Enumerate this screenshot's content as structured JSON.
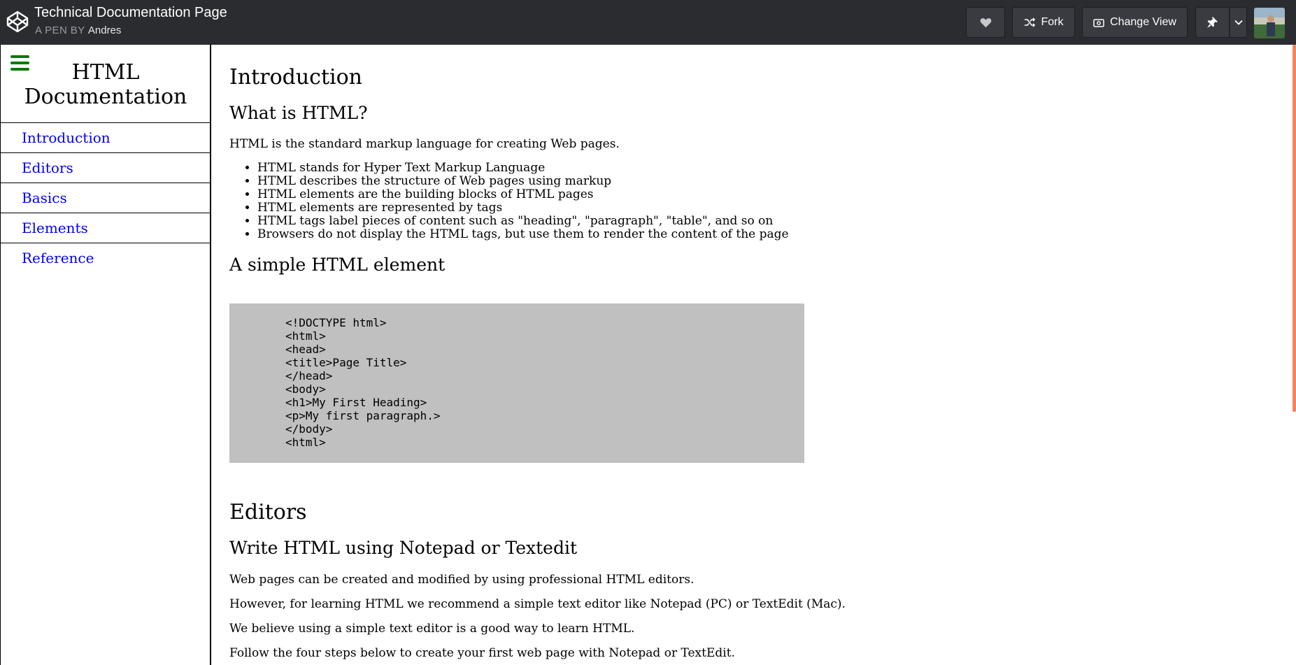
{
  "topbar": {
    "title": "Technical Documentation Page",
    "by_label": "A PEN BY",
    "author": "Andres",
    "buttons": {
      "fork": "Fork",
      "change_view": "Change View"
    },
    "icons": [
      "codepen-logo-icon",
      "heart-icon",
      "fork-icon",
      "change-view-icon",
      "pin-icon",
      "chevron-down-icon"
    ]
  },
  "sidebar": {
    "title_line1": "HTML",
    "title_line2": "Documentation",
    "items": [
      {
        "label": "Introduction"
      },
      {
        "label": "Editors"
      },
      {
        "label": "Basics"
      },
      {
        "label": "Elements"
      },
      {
        "label": "Reference"
      }
    ],
    "accent_color": "#0a7a0a",
    "link_color": "#0000ee"
  },
  "main": {
    "intro": {
      "heading": "Introduction",
      "subheading": "What is HTML?",
      "paragraph": "HTML is the standard markup language for creating Web pages.",
      "bullets": [
        "HTML stands for Hyper Text Markup Language",
        "HTML describes the structure of Web pages using markup",
        "HTML elements are the building blocks of HTML pages",
        "HTML elements are represented by tags",
        "HTML tags label pieces of content such as \"heading\", \"paragraph\", \"table\", and so on",
        "Browsers do not display the HTML tags, but use them to render the content of the page"
      ],
      "simple_heading": "A simple HTML element",
      "code_lines": [
        "<!DOCTYPE html>",
        "<html>",
        "<head>",
        "<title>Page Title>",
        "</head>",
        "<body>",
        "<h1>My First Heading>",
        "<p>My first paragraph.>",
        "</body>",
        "<html>"
      ]
    },
    "editors": {
      "heading": "Editors",
      "subheading": "Write HTML using Notepad or Textedit",
      "paragraphs": [
        "Web pages can be created and modified by using professional HTML editors.",
        "However, for learning HTML we recommend a simple text editor like Notepad (PC) or TextEdit (Mac).",
        "We believe using a simple text editor is a good way to learn HTML.",
        "Follow the four steps below to create your first web page with Notepad or TextEdit."
      ]
    }
  },
  "colors": {
    "topbar_bg": "#2b2c30",
    "code_bg": "#c0c0c0",
    "scrollbar_thumb": "#f0855f"
  }
}
